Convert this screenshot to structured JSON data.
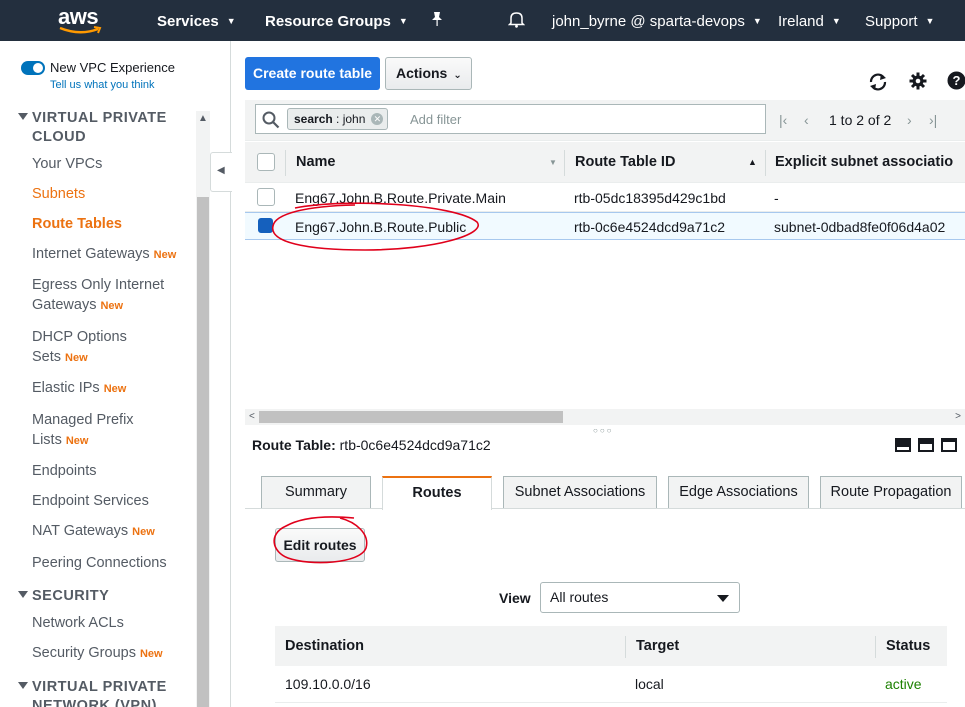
{
  "topnav": {
    "logo": "aws",
    "services": "Services",
    "resource_groups": "Resource Groups",
    "account": "john_byrne @ sparta-devops",
    "region": "Ireland",
    "support": "Support"
  },
  "sidebar": {
    "new_vpc_experience": "New VPC Experience",
    "tell_us": "Tell us what you think",
    "section_vpc": "VIRTUAL PRIVATE CLOUD",
    "items": [
      {
        "label": "Your VPCs"
      },
      {
        "label": "Subnets"
      },
      {
        "label": "Route Tables"
      },
      {
        "label": "Internet Gateways",
        "badge": "New"
      },
      {
        "label_line1": "Egress Only Internet",
        "label_line2": "Gateways",
        "badge": "New"
      },
      {
        "label_line1": "DHCP Options",
        "label_line2": "Sets",
        "badge": "New"
      },
      {
        "label": "Elastic IPs",
        "badge": "New"
      },
      {
        "label_line1": "Managed Prefix",
        "label_line2": "Lists",
        "badge": "New"
      },
      {
        "label": "Endpoints"
      },
      {
        "label": "Endpoint Services"
      },
      {
        "label": "NAT Gateways",
        "badge": "New"
      },
      {
        "label": "Peering Connections"
      }
    ],
    "section_security": "SECURITY",
    "security_items": [
      {
        "label": "Network ACLs"
      },
      {
        "label": "Security Groups",
        "badge": "New"
      }
    ],
    "section_vpn": "VIRTUAL PRIVATE NETWORK (VPN)"
  },
  "toolbar": {
    "create_label": "Create route table",
    "actions_label": "Actions"
  },
  "filter": {
    "tag_key": "search",
    "tag_value": "john",
    "placeholder": "Add filter",
    "pagination": "1 to 2 of 2"
  },
  "table": {
    "columns": [
      "Name",
      "Route Table ID",
      "Explicit subnet associatio"
    ],
    "rows": [
      {
        "name": "Eng67.John.B.Route.Private.Main",
        "id": "rtb-05dc18395d429c1bd",
        "subnet": "-",
        "selected": false
      },
      {
        "name": "Eng67.John.B.Route.Public",
        "id": "rtb-0c6e4524dcd9a71c2",
        "subnet": "subnet-0dbad8fe0f06d4a02",
        "selected": true
      }
    ]
  },
  "details": {
    "label": "Route Table:",
    "value": "rtb-0c6e4524dcd9a71c2",
    "tabs": [
      "Summary",
      "Routes",
      "Subnet Associations",
      "Edge Associations",
      "Route Propagation"
    ],
    "active_tab": "Routes",
    "edit_routes": "Edit routes",
    "view_label": "View",
    "view_selected": "All routes",
    "routes_columns": [
      "Destination",
      "Target",
      "Status"
    ],
    "routes": [
      {
        "destination": "109.10.0.0/16",
        "target": "local",
        "status": "active"
      }
    ]
  },
  "colors": {
    "nav_bg": "#232f3e",
    "accent_orange": "#ec7211",
    "primary_blue": "#2174e0",
    "status_active": "#1d8102",
    "annotation_red": "#e0001b"
  }
}
